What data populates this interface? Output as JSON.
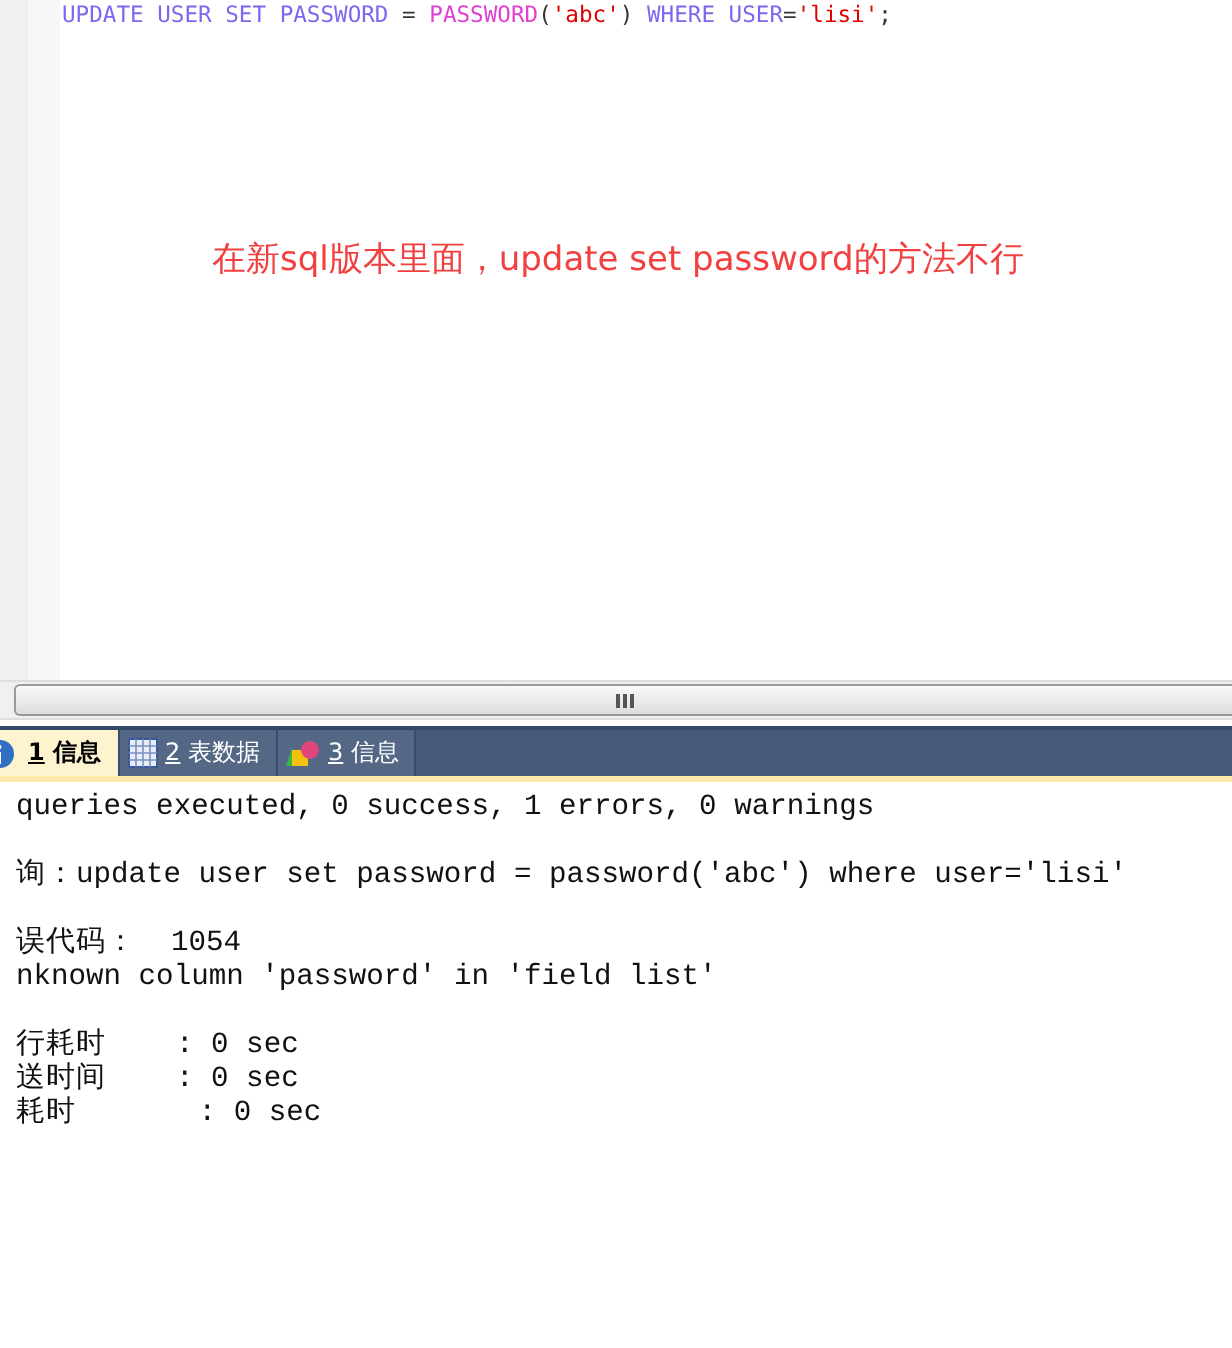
{
  "editor": {
    "code": [
      {
        "kind": "keyword",
        "text": "UPDATE USER SET PASSWORD"
      },
      {
        "kind": "operator",
        "text": " = "
      },
      {
        "kind": "function",
        "text": "PASSWORD"
      },
      {
        "kind": "operator",
        "text": "("
      },
      {
        "kind": "string",
        "text": "'abc'"
      },
      {
        "kind": "operator",
        "text": ")"
      },
      {
        "kind": "keyword",
        "text": " WHERE USER"
      },
      {
        "kind": "operator",
        "text": "="
      },
      {
        "kind": "string",
        "text": "'lisi'"
      },
      {
        "kind": "operator",
        "text": ";"
      }
    ],
    "annotation": "在新sql版本里面，update set password的方法不行"
  },
  "tabs": [
    {
      "number": "1",
      "label": "信息",
      "kind": "info",
      "selected": true
    },
    {
      "number": "2",
      "label": "表数据",
      "kind": "grid",
      "selected": false
    },
    {
      "number": "3",
      "label": "信息",
      "kind": "shapes",
      "selected": false
    }
  ],
  "output": {
    "blocks": [
      [
        "queries executed, 0 success, 1 errors, 0 warnings"
      ],
      [
        "询：update user set password = password('abc') where user='lisi'"
      ],
      [
        "误代码：  1054",
        "nknown column 'password' in 'field list'"
      ],
      [
        "行耗时    : 0 sec",
        "送时间    : 0 sec",
        "耗时       : 0 sec"
      ]
    ]
  }
}
